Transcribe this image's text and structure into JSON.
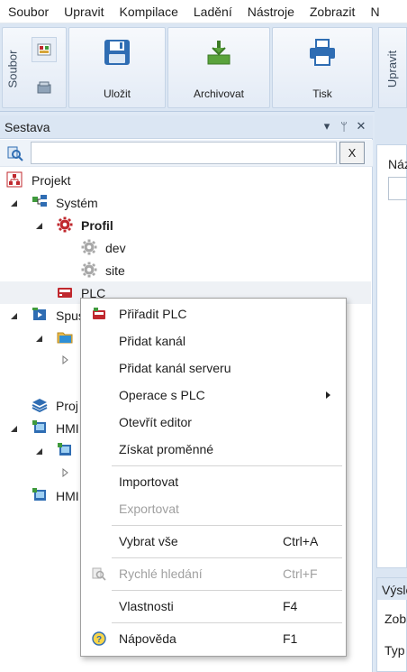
{
  "menubar": {
    "items": [
      "Soubor",
      "Upravit",
      "Kompilace",
      "Ladění",
      "Nástroje",
      "Zobrazit",
      "N"
    ]
  },
  "ribbon": {
    "group_left_label": "Soubor",
    "buttons": [
      "Uložit",
      "Archivovat",
      "Tisk"
    ],
    "right_group_label": "Upravit"
  },
  "panel": {
    "title": "Sestava",
    "search_placeholder": "",
    "search_clear": "X",
    "header_icons": [
      "▾",
      "ᛘ",
      "✕"
    ]
  },
  "tree": {
    "nodes": [
      "Projekt",
      "Systém",
      "Profil",
      "dev",
      "site",
      "PLC",
      "Spus",
      "Proj",
      "HMI",
      "HMI"
    ]
  },
  "right": {
    "doc_label": "Náz",
    "bottom_header": "Výsle",
    "row1": "Zob",
    "row2": "Typ"
  },
  "context_menu": {
    "items": [
      {
        "label": "Přiřadit PLC",
        "shortcut": "",
        "disabled": false,
        "icon": "plc-icon"
      },
      {
        "label": "Přidat kanál",
        "shortcut": "",
        "disabled": false
      },
      {
        "label": "Přidat kanál serveru",
        "shortcut": "",
        "disabled": false
      },
      {
        "label": "Operace s PLC",
        "shortcut": "",
        "disabled": false,
        "submenu": true
      },
      {
        "label": "Otevřít editor",
        "shortcut": "",
        "disabled": false
      },
      {
        "label": "Získat proměnné",
        "shortcut": "",
        "disabled": false
      },
      {
        "label": "Importovat",
        "shortcut": "",
        "disabled": false
      },
      {
        "label": "Exportovat",
        "shortcut": "",
        "disabled": true
      },
      {
        "label": "Vybrat vše",
        "shortcut": "Ctrl+A",
        "disabled": false
      },
      {
        "label": "Rychlé hledání",
        "shortcut": "Ctrl+F",
        "disabled": true,
        "icon": "quick-search-icon"
      },
      {
        "label": "Vlastnosti",
        "shortcut": "F4",
        "disabled": false
      },
      {
        "label": "Nápověda",
        "shortcut": "F1",
        "disabled": false,
        "icon": "help-icon"
      }
    ]
  },
  "colors": {
    "ribbon_bg": "#dbe6f3",
    "accent_red": "#c0282e",
    "disabled_text": "#a0a0a0"
  }
}
